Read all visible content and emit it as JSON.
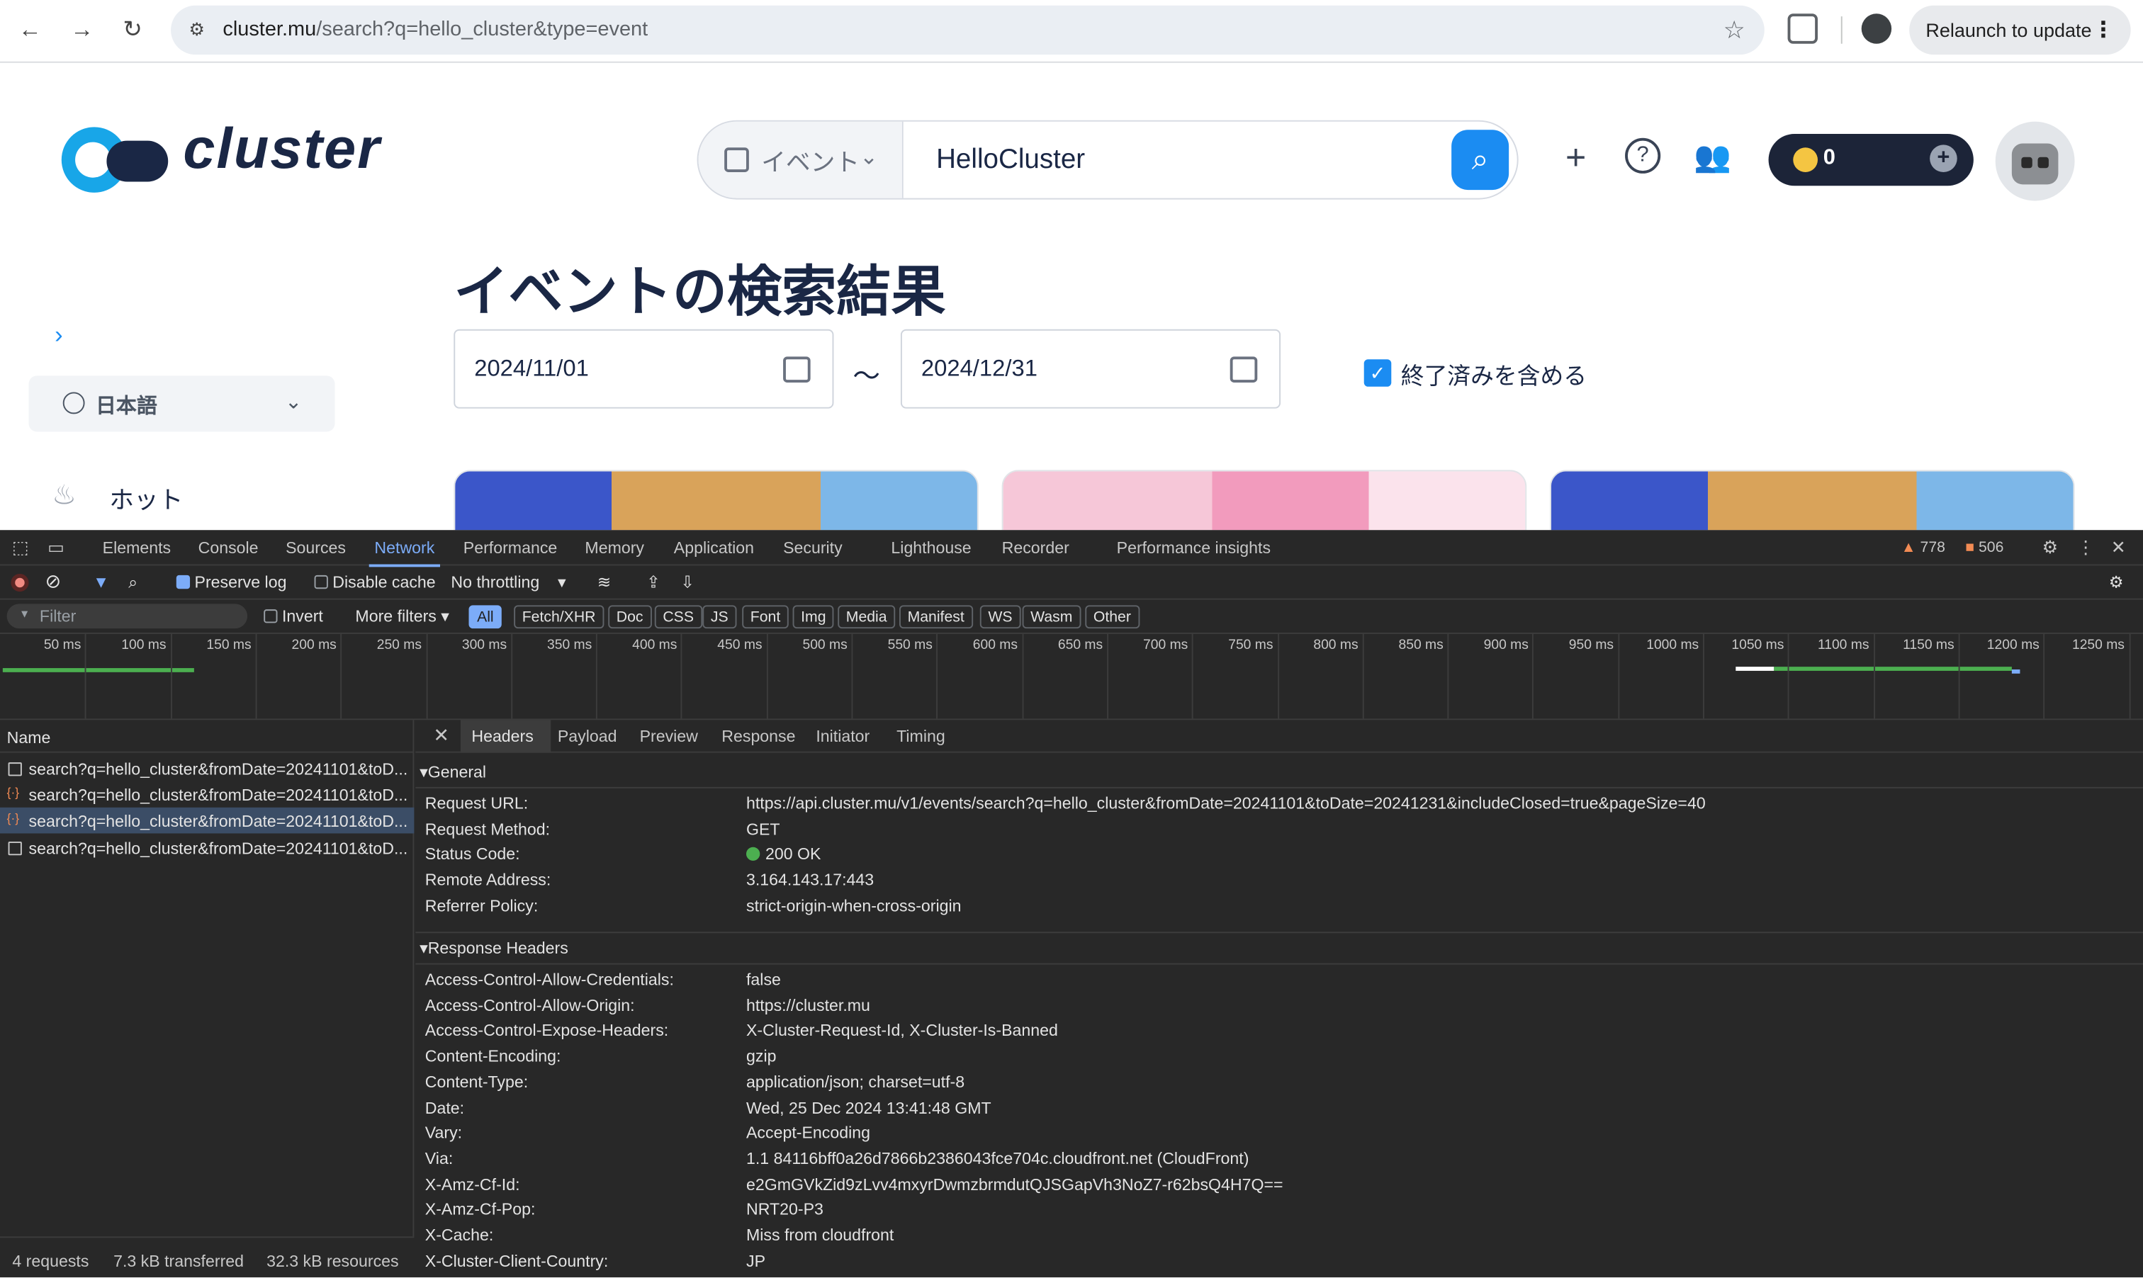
{
  "browser": {
    "url_host": "cluster.mu",
    "url_path": "/search?q=hello_cluster&type=event",
    "relaunch": "Relaunch to update"
  },
  "site": {
    "logo": "cluster",
    "search_type": "イベント",
    "search_query": "HelloCluster",
    "coins": "0",
    "title": "イベントの検索結果",
    "language": "日本語",
    "nav_hot": "ホット",
    "from_date": "2024/11/01",
    "to_date": "2024/12/31",
    "range_sep": "～",
    "include_closed": "終了済みを含める"
  },
  "devtools": {
    "tabs": [
      "Elements",
      "Console",
      "Sources",
      "Network",
      "Performance",
      "Memory",
      "Application",
      "Security",
      "Lighthouse",
      "Recorder",
      "Performance insights"
    ],
    "warnings": "778",
    "errors": "506",
    "preserve_log": "Preserve log",
    "disable_cache": "Disable cache",
    "throttling": "No throttling",
    "filter_placeholder": "Filter",
    "invert": "Invert",
    "more_filters": "More filters",
    "type_filters": [
      "All",
      "Fetch/XHR",
      "Doc",
      "CSS",
      "JS",
      "Font",
      "Img",
      "Media",
      "Manifest",
      "WS",
      "Wasm",
      "Other"
    ],
    "timeline_ticks": [
      "50 ms",
      "100 ms",
      "150 ms",
      "200 ms",
      "250 ms",
      "300 ms",
      "350 ms",
      "400 ms",
      "450 ms",
      "500 ms",
      "550 ms",
      "600 ms",
      "650 ms",
      "700 ms",
      "750 ms",
      "800 ms",
      "850 ms",
      "900 ms",
      "950 ms",
      "1000 ms",
      "1050 ms",
      "1100 ms",
      "1150 ms",
      "1200 ms",
      "1250 ms"
    ],
    "name_header": "Name",
    "requests": [
      "search?q=hello_cluster&fromDate=20241101&toD...",
      "search?q=hello_cluster&fromDate=20241101&toD...",
      "search?q=hello_cluster&fromDate=20241101&toD...",
      "search?q=hello_cluster&fromDate=20241101&toD..."
    ],
    "detail_tabs": [
      "Headers",
      "Payload",
      "Preview",
      "Response",
      "Initiator",
      "Timing"
    ],
    "general_title": "General",
    "general": [
      {
        "k": "Request URL:",
        "v": "https://api.cluster.mu/v1/events/search?q=hello_cluster&fromDate=20241101&toDate=20241231&includeClosed=true&pageSize=40"
      },
      {
        "k": "Request Method:",
        "v": "GET"
      },
      {
        "k": "Status Code:",
        "v": "200 OK"
      },
      {
        "k": "Remote Address:",
        "v": "3.164.143.17:443"
      },
      {
        "k": "Referrer Policy:",
        "v": "strict-origin-when-cross-origin"
      }
    ],
    "response_title": "Response Headers",
    "response_headers": [
      {
        "k": "Access-Control-Allow-Credentials:",
        "v": "false"
      },
      {
        "k": "Access-Control-Allow-Origin:",
        "v": "https://cluster.mu"
      },
      {
        "k": "Access-Control-Expose-Headers:",
        "v": "X-Cluster-Request-Id, X-Cluster-Is-Banned"
      },
      {
        "k": "Content-Encoding:",
        "v": "gzip"
      },
      {
        "k": "Content-Type:",
        "v": "application/json; charset=utf-8"
      },
      {
        "k": "Date:",
        "v": "Wed, 25 Dec 2024 13:41:48 GMT"
      },
      {
        "k": "Vary:",
        "v": "Accept-Encoding"
      },
      {
        "k": "Via:",
        "v": "1.1 84116bff0a26d7866b2386043fce704c.cloudfront.net (CloudFront)"
      },
      {
        "k": "X-Amz-Cf-Id:",
        "v": "e2GmGVkZid9zLvv4mxyrDwmzbrmdutQJSGapVh3NoZ7-r62bsQ4H7Q=="
      },
      {
        "k": "X-Amz-Cf-Pop:",
        "v": "NRT20-P3"
      },
      {
        "k": "X-Cache:",
        "v": "Miss from cloudfront"
      },
      {
        "k": "X-Cluster-Client-Country:",
        "v": "JP"
      }
    ],
    "status_requests": "4 requests",
    "status_transferred": "7.3 kB transferred",
    "status_resources": "32.3 kB resources"
  }
}
